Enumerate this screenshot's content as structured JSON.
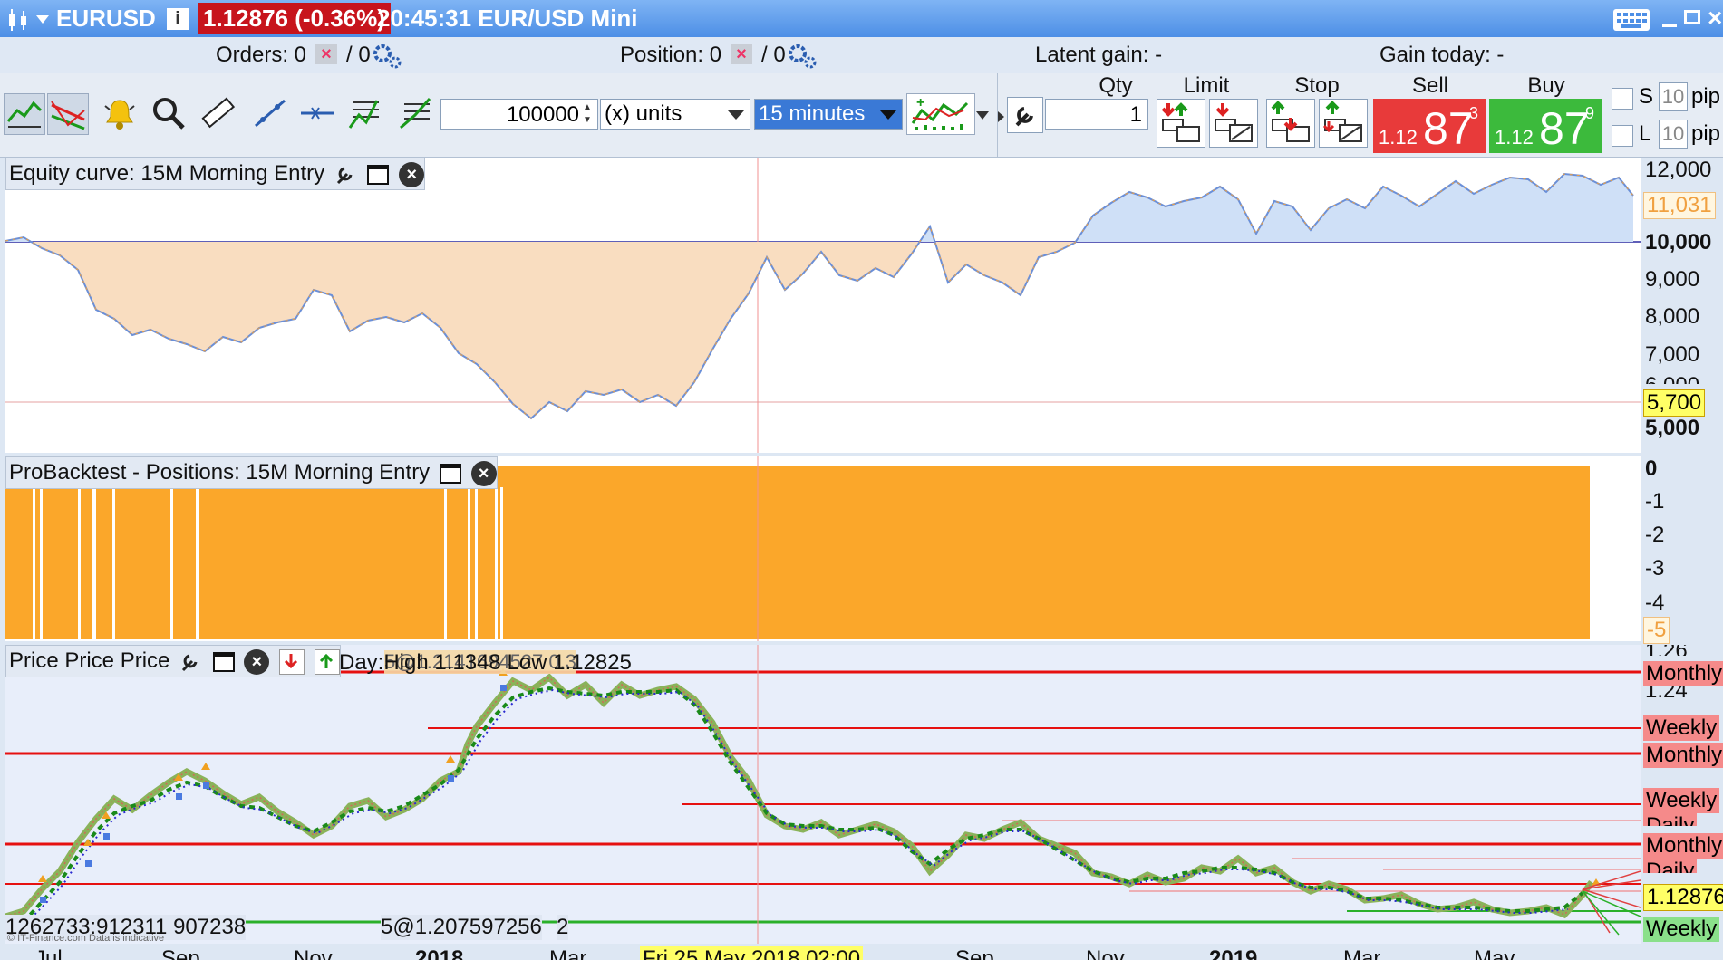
{
  "titlebar": {
    "symbol": "EURUSD",
    "price_badge": "1.12876 (-0.36%)",
    "time_and_name": "20:45:31 EUR/USD Mini"
  },
  "ordersbar": {
    "orders_label": "Orders: 0",
    "orders_suffix": "/ 0",
    "position_label": "Position: 0",
    "position_suffix": "/ 0",
    "latent_gain": "Latent gain: -",
    "gain_today": "Gain today: -"
  },
  "toolbar": {
    "quantity_value": "100000",
    "units_select": "(x) units",
    "timeframe_select": "15 minutes",
    "qty_header": "Qty",
    "limit_header": "Limit",
    "stop_header": "Stop",
    "sell_header": "Sell",
    "buy_header": "Buy",
    "qty_value": "1",
    "sell_small": "1.12",
    "sell_big": "87",
    "sell_sup": "3",
    "buy_small": "1.12",
    "buy_big": "87",
    "buy_sup": "9",
    "s_label": "S",
    "l_label": "L",
    "s_pips": "10",
    "l_pips": "10",
    "pip_label": "pip",
    "accent_sell": "#e83a3a",
    "accent_buy": "#3cba3c"
  },
  "equity_panel": {
    "title": "Equity curve: 15M Morning Entry",
    "axis": [
      "12,000",
      "10,000",
      "9,000",
      "8,000",
      "7,000",
      "5,000"
    ],
    "axis_partial": "6,000",
    "current_value": "11,031",
    "low_value": "5,700"
  },
  "positions_panel": {
    "title": "ProBacktest - Positions: 15M Morning Entry",
    "axis": [
      "0",
      "-1",
      "-2",
      "-3",
      "-4"
    ],
    "current_value": "-5"
  },
  "price_panel": {
    "title": "Price Price Price",
    "overlay_text": "Day:High 1.1348 Low 1.12825",
    "overlay_labels_garbled": "5@1.2141694527 0.3",
    "bottom_label_left": "1262733:912311 907238",
    "bottom_label_mid": "5@1.207597256",
    "bottom_label_right": "2",
    "watermark": "© IT-Finance.com Data is indicative",
    "axis_partial_top": "1.26",
    "axis_124": "1.24",
    "current_price": "1.12876",
    "level_labels": [
      "Monthly",
      "Weekly",
      "Monthly",
      "Weekly",
      "Daily",
      "Monthly",
      "Daily",
      "Weekly"
    ]
  },
  "xaxis": {
    "labels": [
      "Jul",
      "Sep",
      "Nov",
      "2018",
      "Mar",
      "Sep",
      "Nov",
      "2019",
      "Mar",
      "May"
    ],
    "cursor_label": "Fri 25 May 2018 02:00"
  }
}
